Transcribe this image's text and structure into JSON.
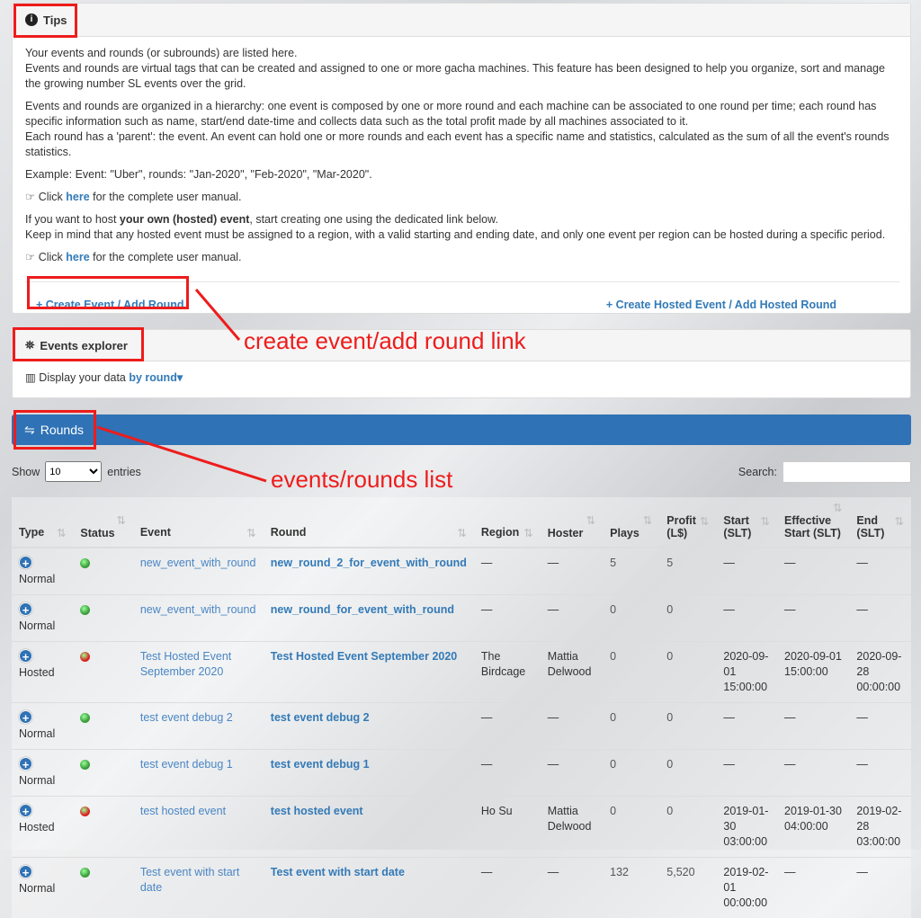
{
  "tips": {
    "title": "Tips",
    "icon": "info-icon",
    "p1": "Your events and rounds (or subrounds) are listed here.",
    "p1b": "Events and rounds are virtual tags that can be created and assigned to one or more gacha machines. This feature has been designed to help you organize, sort and manage the growing number SL events over the grid.",
    "p2": "Events and rounds are organized in a hierarchy: one event is composed by one or more round and each machine can be associated to one round per time; each round has specific information such as name, start/end date-time and collects data such as the total profit made by all machines associated to it.",
    "p2b": "Each round has a 'parent': the event. An event can hold one or more rounds and each event has a specific name and statistics, calculated as the sum of all the event's rounds statistics.",
    "p3": "Example: Event: \"Uber\", rounds: \"Jan-2020\", \"Feb-2020\", \"Mar-2020\".",
    "click": "Click",
    "here": "here",
    "manual": "for the complete user manual.",
    "host_pre": "If you want to host ",
    "host_bold": "your own (hosted) event",
    "host_post": ", start creating one using the dedicated link below.",
    "host2": "Keep in mind that any hosted event must be assigned to a region, with a valid starting and ending date, and only one event per region can be hosted during a specific period.",
    "create": "Create Event / Add Round",
    "create_hosted": "Create Hosted Event / Add Hosted Round"
  },
  "explorer": {
    "title": "Events explorer",
    "display": "Display your data",
    "by": "by round"
  },
  "rounds": {
    "title": "Rounds",
    "show": "Show",
    "entries": "entries",
    "page_size": "10",
    "search": "Search:",
    "headers": [
      "Type",
      "Status",
      "Event",
      "Round",
      "Region",
      "Hoster",
      "Plays",
      "Profit (L$)",
      "Start (SLT)",
      "Effective Start (SLT)",
      "End (SLT)"
    ],
    "rows": [
      {
        "type": "Normal",
        "status": "green",
        "event": "new_event_with_round",
        "round": "new_round_2_for_event_with_round",
        "region": "—",
        "hoster": "—",
        "plays": "5",
        "profit": "5",
        "start": "—",
        "eff": "—",
        "end": "—"
      },
      {
        "type": "Normal",
        "status": "green",
        "event": "new_event_with_round",
        "round": "new_round_for_event_with_round",
        "region": "—",
        "hoster": "—",
        "plays": "0",
        "profit": "0",
        "start": "—",
        "eff": "—",
        "end": "—"
      },
      {
        "type": "Hosted",
        "status": "red",
        "event": "Test Hosted Event September 2020",
        "round": "Test Hosted Event September 2020",
        "region": "The Birdcage",
        "hoster": "Mattia Delwood",
        "plays": "0",
        "profit": "0",
        "start": "2020-09-01 15:00:00",
        "eff": "2020-09-01 15:00:00",
        "end": "2020-09-28 00:00:00"
      },
      {
        "type": "Normal",
        "status": "green",
        "event": "test event debug 2",
        "round": "test event debug 2",
        "region": "—",
        "hoster": "—",
        "plays": "0",
        "profit": "0",
        "start": "—",
        "eff": "—",
        "end": "—"
      },
      {
        "type": "Normal",
        "status": "green",
        "event": "test event debug 1",
        "round": "test event debug 1",
        "region": "—",
        "hoster": "—",
        "plays": "0",
        "profit": "0",
        "start": "—",
        "eff": "—",
        "end": "—"
      },
      {
        "type": "Hosted",
        "status": "red",
        "event": "test hosted event",
        "round": "test hosted event",
        "region": "Ho Su",
        "hoster": "Mattia Delwood",
        "plays": "0",
        "profit": "0",
        "start": "2019-01-30 03:00:00",
        "eff": "2019-01-30 04:00:00",
        "end": "2019-02-28 03:00:00"
      },
      {
        "type": "Normal",
        "status": "green",
        "event": "Test event with start date",
        "round": "Test event with start date",
        "region": "—",
        "hoster": "—",
        "plays": "132",
        "profit": "5,520",
        "start": "2019-02-01 00:00:00",
        "eff": "—",
        "end": "—"
      }
    ]
  },
  "annotations": {
    "a1": "create event/add round link",
    "a2": "events/rounds list"
  },
  "colors": {
    "accent": "#337ab7",
    "annotation": "#ee1c1c",
    "green": "#3a9d3a",
    "red": "#d9231d"
  }
}
